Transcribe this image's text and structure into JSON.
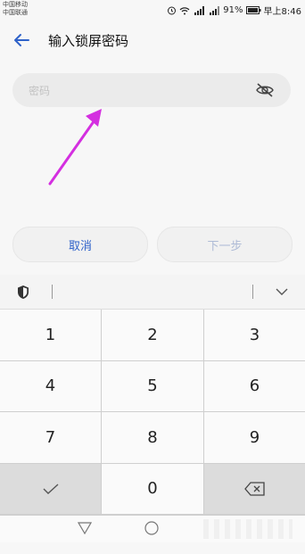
{
  "status_bar": {
    "carrier_1": "中国移动",
    "carrier_2": "中国联通",
    "battery": "91%",
    "time": "早上8:46"
  },
  "header": {
    "title": "输入锁屏密码"
  },
  "password_field": {
    "placeholder": "密码"
  },
  "buttons": {
    "cancel": "取消",
    "next": "下一步"
  },
  "keyboard": {
    "keys": [
      "1",
      "2",
      "3",
      "4",
      "5",
      "6",
      "7",
      "8",
      "9",
      "0"
    ]
  },
  "colors": {
    "accent": "#2f62c9",
    "annotation_arrow": "#d42fe0"
  },
  "icons": [
    "back-arrow-icon",
    "eye-slash-icon",
    "shield-icon",
    "chevron-down-icon",
    "checkmark-icon",
    "backspace-icon",
    "nav-back-icon",
    "nav-home-icon"
  ]
}
